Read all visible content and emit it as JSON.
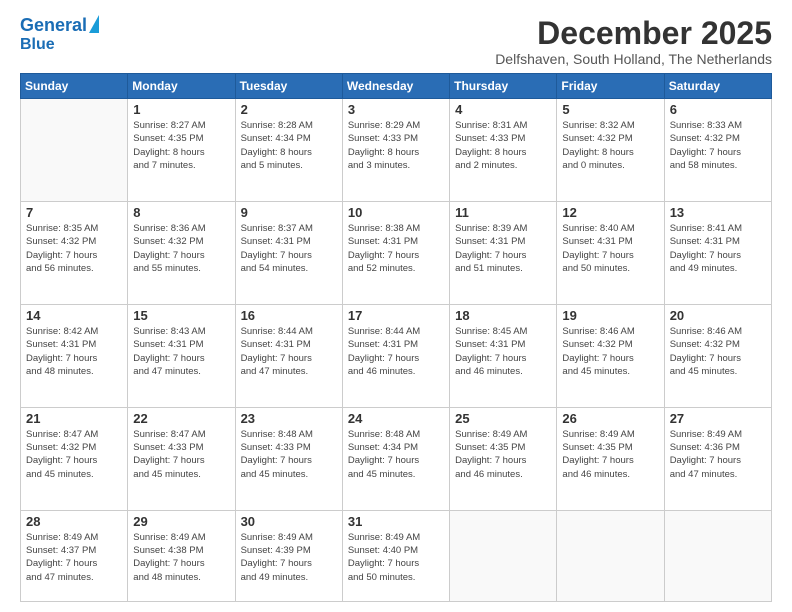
{
  "header": {
    "logo_line1": "General",
    "logo_line2": "Blue",
    "month": "December 2025",
    "location": "Delfshaven, South Holland, The Netherlands"
  },
  "weekdays": [
    "Sunday",
    "Monday",
    "Tuesday",
    "Wednesday",
    "Thursday",
    "Friday",
    "Saturday"
  ],
  "weeks": [
    [
      {
        "day": "",
        "info": ""
      },
      {
        "day": "1",
        "info": "Sunrise: 8:27 AM\nSunset: 4:35 PM\nDaylight: 8 hours\nand 7 minutes."
      },
      {
        "day": "2",
        "info": "Sunrise: 8:28 AM\nSunset: 4:34 PM\nDaylight: 8 hours\nand 5 minutes."
      },
      {
        "day": "3",
        "info": "Sunrise: 8:29 AM\nSunset: 4:33 PM\nDaylight: 8 hours\nand 3 minutes."
      },
      {
        "day": "4",
        "info": "Sunrise: 8:31 AM\nSunset: 4:33 PM\nDaylight: 8 hours\nand 2 minutes."
      },
      {
        "day": "5",
        "info": "Sunrise: 8:32 AM\nSunset: 4:32 PM\nDaylight: 8 hours\nand 0 minutes."
      },
      {
        "day": "6",
        "info": "Sunrise: 8:33 AM\nSunset: 4:32 PM\nDaylight: 7 hours\nand 58 minutes."
      }
    ],
    [
      {
        "day": "7",
        "info": "Sunrise: 8:35 AM\nSunset: 4:32 PM\nDaylight: 7 hours\nand 56 minutes."
      },
      {
        "day": "8",
        "info": "Sunrise: 8:36 AM\nSunset: 4:32 PM\nDaylight: 7 hours\nand 55 minutes."
      },
      {
        "day": "9",
        "info": "Sunrise: 8:37 AM\nSunset: 4:31 PM\nDaylight: 7 hours\nand 54 minutes."
      },
      {
        "day": "10",
        "info": "Sunrise: 8:38 AM\nSunset: 4:31 PM\nDaylight: 7 hours\nand 52 minutes."
      },
      {
        "day": "11",
        "info": "Sunrise: 8:39 AM\nSunset: 4:31 PM\nDaylight: 7 hours\nand 51 minutes."
      },
      {
        "day": "12",
        "info": "Sunrise: 8:40 AM\nSunset: 4:31 PM\nDaylight: 7 hours\nand 50 minutes."
      },
      {
        "day": "13",
        "info": "Sunrise: 8:41 AM\nSunset: 4:31 PM\nDaylight: 7 hours\nand 49 minutes."
      }
    ],
    [
      {
        "day": "14",
        "info": "Sunrise: 8:42 AM\nSunset: 4:31 PM\nDaylight: 7 hours\nand 48 minutes."
      },
      {
        "day": "15",
        "info": "Sunrise: 8:43 AM\nSunset: 4:31 PM\nDaylight: 7 hours\nand 47 minutes."
      },
      {
        "day": "16",
        "info": "Sunrise: 8:44 AM\nSunset: 4:31 PM\nDaylight: 7 hours\nand 47 minutes."
      },
      {
        "day": "17",
        "info": "Sunrise: 8:44 AM\nSunset: 4:31 PM\nDaylight: 7 hours\nand 46 minutes."
      },
      {
        "day": "18",
        "info": "Sunrise: 8:45 AM\nSunset: 4:31 PM\nDaylight: 7 hours\nand 46 minutes."
      },
      {
        "day": "19",
        "info": "Sunrise: 8:46 AM\nSunset: 4:32 PM\nDaylight: 7 hours\nand 45 minutes."
      },
      {
        "day": "20",
        "info": "Sunrise: 8:46 AM\nSunset: 4:32 PM\nDaylight: 7 hours\nand 45 minutes."
      }
    ],
    [
      {
        "day": "21",
        "info": "Sunrise: 8:47 AM\nSunset: 4:32 PM\nDaylight: 7 hours\nand 45 minutes."
      },
      {
        "day": "22",
        "info": "Sunrise: 8:47 AM\nSunset: 4:33 PM\nDaylight: 7 hours\nand 45 minutes."
      },
      {
        "day": "23",
        "info": "Sunrise: 8:48 AM\nSunset: 4:33 PM\nDaylight: 7 hours\nand 45 minutes."
      },
      {
        "day": "24",
        "info": "Sunrise: 8:48 AM\nSunset: 4:34 PM\nDaylight: 7 hours\nand 45 minutes."
      },
      {
        "day": "25",
        "info": "Sunrise: 8:49 AM\nSunset: 4:35 PM\nDaylight: 7 hours\nand 46 minutes."
      },
      {
        "day": "26",
        "info": "Sunrise: 8:49 AM\nSunset: 4:35 PM\nDaylight: 7 hours\nand 46 minutes."
      },
      {
        "day": "27",
        "info": "Sunrise: 8:49 AM\nSunset: 4:36 PM\nDaylight: 7 hours\nand 47 minutes."
      }
    ],
    [
      {
        "day": "28",
        "info": "Sunrise: 8:49 AM\nSunset: 4:37 PM\nDaylight: 7 hours\nand 47 minutes."
      },
      {
        "day": "29",
        "info": "Sunrise: 8:49 AM\nSunset: 4:38 PM\nDaylight: 7 hours\nand 48 minutes."
      },
      {
        "day": "30",
        "info": "Sunrise: 8:49 AM\nSunset: 4:39 PM\nDaylight: 7 hours\nand 49 minutes."
      },
      {
        "day": "31",
        "info": "Sunrise: 8:49 AM\nSunset: 4:40 PM\nDaylight: 7 hours\nand 50 minutes."
      },
      {
        "day": "",
        "info": ""
      },
      {
        "day": "",
        "info": ""
      },
      {
        "day": "",
        "info": ""
      }
    ]
  ]
}
